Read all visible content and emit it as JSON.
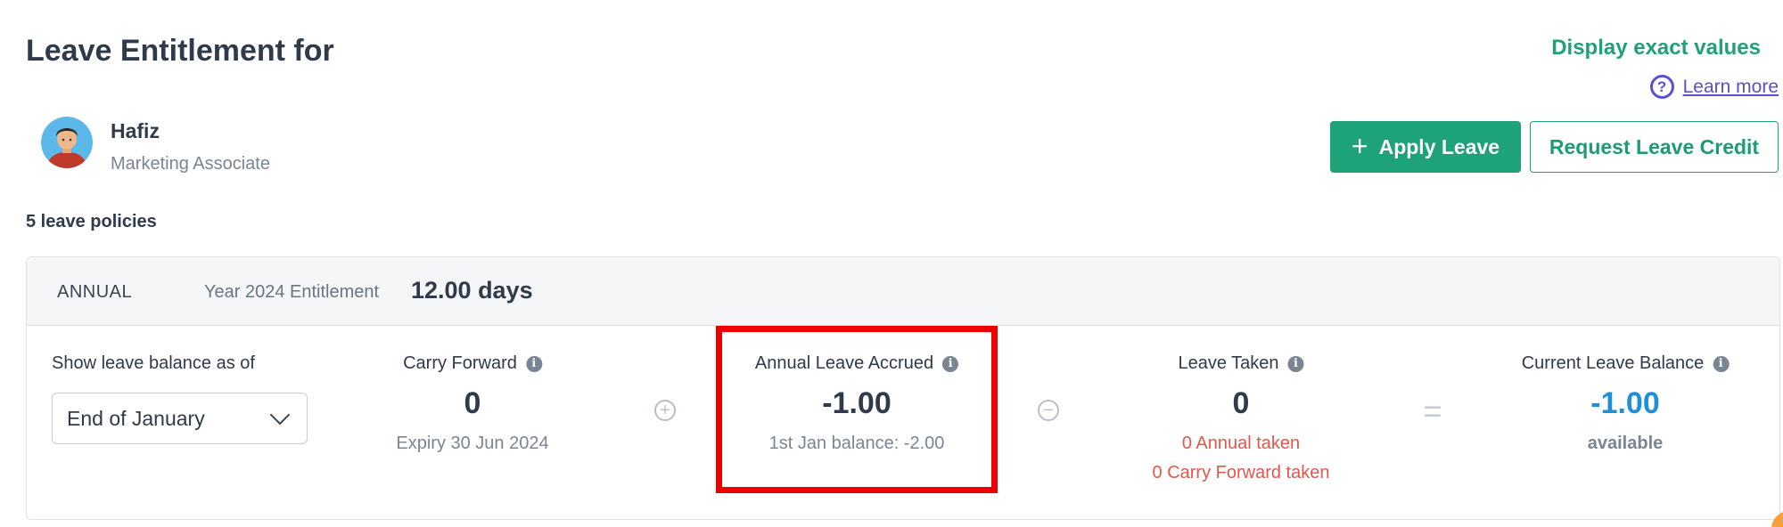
{
  "header": {
    "title": "Leave Entitlement for",
    "display_exact_values": "Display exact values",
    "learn_more": "Learn more",
    "help_icon_glyph": "?"
  },
  "employee": {
    "name": "Hafiz",
    "role": "Marketing Associate"
  },
  "actions": {
    "apply_leave": "Apply Leave",
    "request_credit": "Request Leave Credit",
    "plus_glyph": "+"
  },
  "policies": {
    "count_label": "5 leave policies"
  },
  "policy": {
    "type": "ANNUAL",
    "entitlement_label": "Year 2024 Entitlement",
    "entitlement_value": "12.00 days",
    "as_of_label": "Show leave balance as of",
    "as_of_selected": "End of January",
    "carry_forward": {
      "label": "Carry Forward",
      "value": "0",
      "sub": "Expiry 30 Jun 2024"
    },
    "accrued": {
      "label": "Annual Leave Accrued",
      "value": "-1.00",
      "sub": "1st Jan balance: -2.00"
    },
    "taken": {
      "label": "Leave Taken",
      "value": "0",
      "sub1": "0 Annual taken",
      "sub2": "0 Carry Forward taken"
    },
    "balance": {
      "label": "Current Leave Balance",
      "value": "-1.00",
      "sub": "available"
    },
    "ops": {
      "plus": "+",
      "minus": "−",
      "equals": "="
    }
  },
  "colors": {
    "accent_green": "#1ea27a",
    "link_purple": "#5a4fcf",
    "negative_red": "#e2574c",
    "balance_blue": "#1f8fd8",
    "highlight_red": "#ee0000"
  },
  "icons": {
    "info": "info-icon",
    "help": "question-circle-icon",
    "dropdown": "chevron-down-icon",
    "plus": "plus-icon"
  }
}
